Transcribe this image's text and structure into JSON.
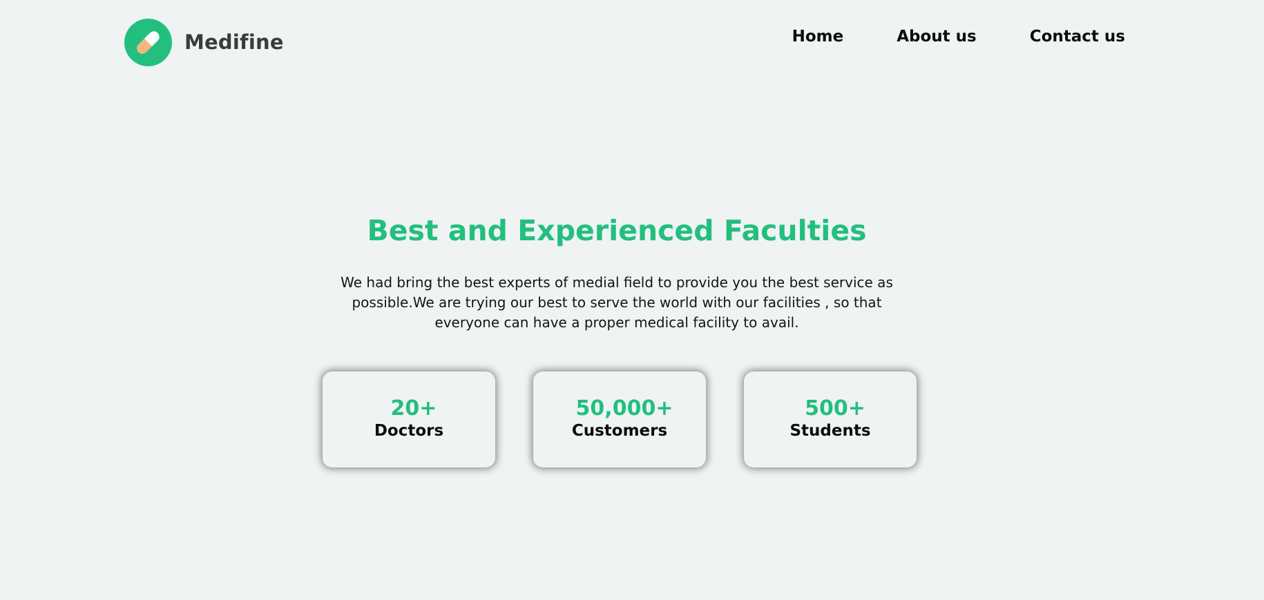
{
  "brand": {
    "name": "Medifine",
    "icon": "pill-icon",
    "accent_color": "#22bf7e"
  },
  "nav": {
    "items": [
      {
        "label": "Home"
      },
      {
        "label": "About us"
      },
      {
        "label": "Contact us"
      }
    ]
  },
  "hero": {
    "title": "Best and Experienced Faculties",
    "description": "We had bring the best experts of medial field to provide you the best service as possible.We are trying our best to serve the world with our facilities , so that everyone can have a proper medical facility to avail."
  },
  "stats": [
    {
      "value": "20+",
      "label": "Doctors"
    },
    {
      "value": "50,000+",
      "label": "Customers"
    },
    {
      "value": "500+",
      "label": "Students"
    }
  ],
  "colors": {
    "background": "#eff3f3",
    "accent": "#22bf7e",
    "text": "#111111",
    "pill_light": "#ffffff",
    "pill_dark": "#f3b77f"
  }
}
